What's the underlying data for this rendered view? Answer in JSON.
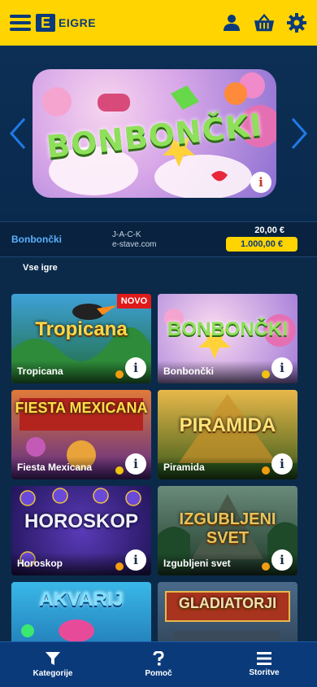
{
  "header": {
    "logo_letter": "E",
    "logo_text": "EIGRE",
    "icons": [
      "menu-icon",
      "user-icon",
      "basket-icon",
      "gear-icon"
    ],
    "accent": "#ffd400",
    "brand": "#0a3a7a"
  },
  "carousel": {
    "title_art": "BONBONČKI",
    "info": "i"
  },
  "details": {
    "name": "Bonbončki",
    "provider_line1": "J-A-C-K",
    "provider_line2": "e-stave.com",
    "min_bet": "20,00 €",
    "max_win": "1.000,00 €"
  },
  "section_title": "Vse igre",
  "games": [
    {
      "name": "Tropicana",
      "art": "Tropicana",
      "badge": "NOVO",
      "dot_color": "#f39c12"
    },
    {
      "name": "Bonbončki",
      "art": "BONBONČKI",
      "badge": "",
      "dot_color": "#f1c40f"
    },
    {
      "name": "Fiesta Mexicana",
      "art": "FIESTA MEXICANA",
      "badge": "",
      "dot_color": "#f1c40f"
    },
    {
      "name": "Piramida",
      "art": "PIRAMIDA",
      "badge": "",
      "dot_color": "#f39c12"
    },
    {
      "name": "Horoskop",
      "art": "HOROSKOP",
      "badge": "",
      "dot_color": "#f39c12"
    },
    {
      "name": "Izgubljeni svet",
      "art": "IZGUBLJENI SVET",
      "badge": "",
      "dot_color": "#f39c12"
    },
    {
      "name": "",
      "art": "AKVARIJ",
      "badge": "",
      "dot_color": ""
    },
    {
      "name": "",
      "art": "GLADIATORJI",
      "badge": "",
      "dot_color": ""
    }
  ],
  "bottom_nav": [
    {
      "label": "Kategorije",
      "icon": "filter-icon"
    },
    {
      "label": "Pomoč",
      "icon": "question-icon"
    },
    {
      "label": "Storitve",
      "icon": "menu-icon"
    }
  ]
}
